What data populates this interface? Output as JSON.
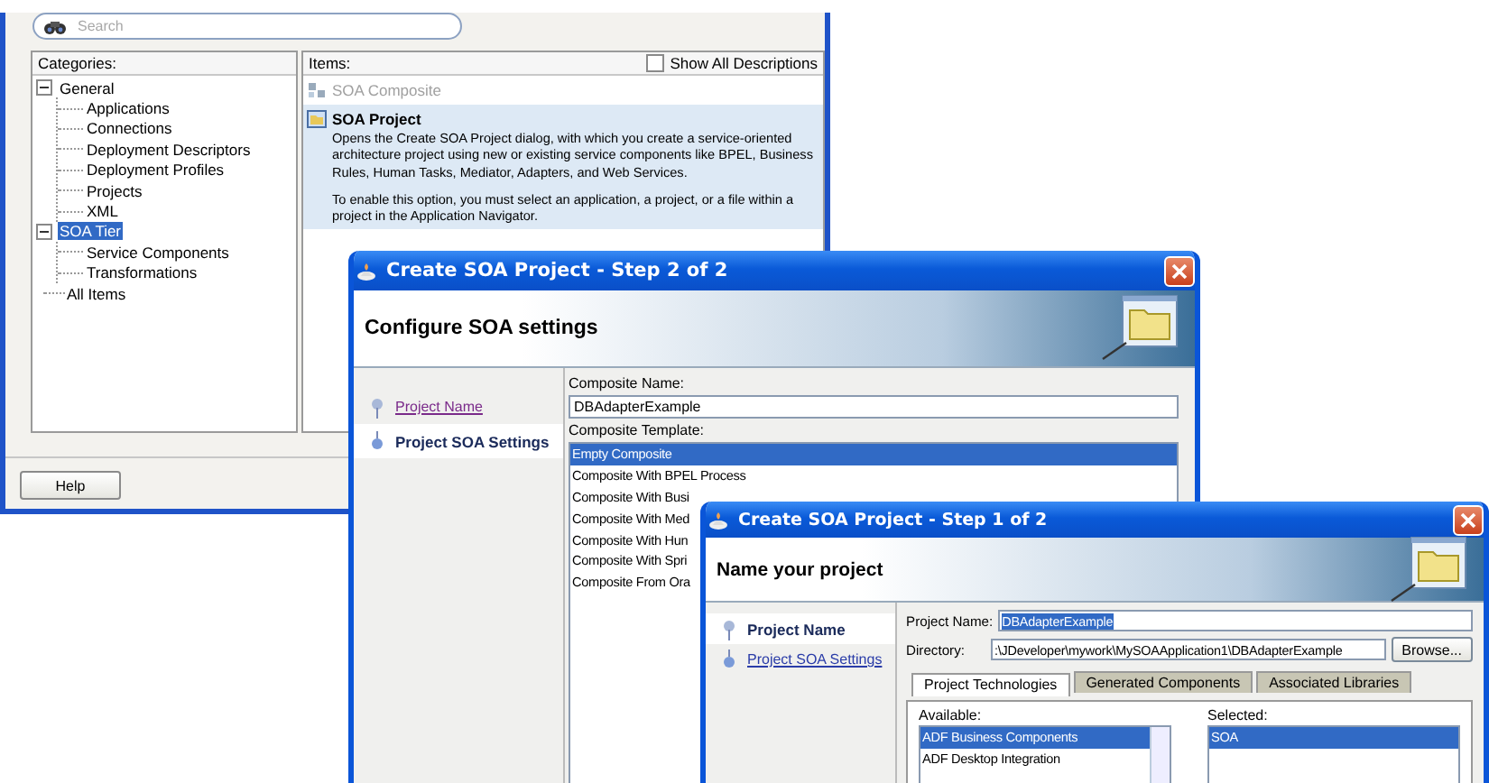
{
  "background_dialog": {
    "search": {
      "placeholder": "Search"
    },
    "categories": {
      "label": "Categories:",
      "tree": [
        {
          "label": "General",
          "expanded": true,
          "selected": false,
          "children": [
            {
              "label": "Applications",
              "selected": false
            },
            {
              "label": "Connections",
              "selected": false
            },
            {
              "label": "Deployment Descriptors",
              "selected": false
            },
            {
              "label": "Deployment Profiles",
              "selected": false
            },
            {
              "label": "Projects",
              "selected": false
            },
            {
              "label": "XML",
              "selected": false
            }
          ]
        },
        {
          "label": "SOA Tier",
          "expanded": true,
          "selected": true,
          "children": [
            {
              "label": "Service Components",
              "selected": false
            },
            {
              "label": "Transformations",
              "selected": false
            }
          ]
        },
        {
          "label": "All Items",
          "selected": false
        }
      ]
    },
    "items": {
      "label": "Items:",
      "show_all_descriptions": {
        "label": "Show All Descriptions",
        "checked": false
      },
      "list": [
        {
          "kind": "category",
          "title": "SOA Composite",
          "disabled": true
        },
        {
          "kind": "item",
          "title": "SOA Project",
          "selected": true,
          "description": [
            "Opens the Create SOA Project dialog, with which you create a service-oriented architecture project using new or existing service components like BPEL, Business Rules, Human Tasks, Mediator, Adapters, and Web Services.",
            "To enable this option, you must select an application, a project, or a file within a project in the Application Navigator."
          ]
        }
      ]
    },
    "help_button": "Help"
  },
  "step2_dialog": {
    "title": "Create SOA Project - Step 2 of 2",
    "heading": "Configure SOA settings",
    "nav": [
      {
        "label": "Project Name",
        "selected": false,
        "visited": true
      },
      {
        "label": "Project SOA Settings",
        "selected": true,
        "visited": false
      }
    ],
    "fields": [
      {
        "kind": "text",
        "label": "Composite Name:",
        "value": "DBAdapterExample",
        "highlighted": false
      },
      {
        "kind": "list",
        "label": "Composite Template:",
        "items": [
          {
            "label": "Empty Composite",
            "selected": true
          },
          {
            "label": "Composite With BPEL Process",
            "selected": false
          },
          {
            "label": "Composite With Busi",
            "selected": false
          },
          {
            "label": "Composite With Med",
            "selected": false
          },
          {
            "label": "Composite With Hun",
            "selected": false
          },
          {
            "label": "Composite With Spri",
            "selected": false
          },
          {
            "label": "Composite From Ora",
            "selected": false
          }
        ]
      }
    ]
  },
  "step1_dialog": {
    "title": "Create SOA Project - Step 1 of 2",
    "heading": "Name your project",
    "nav": [
      {
        "label": "Project Name",
        "selected": true,
        "visited": false
      },
      {
        "label": "Project SOA Settings",
        "selected": false,
        "visited": false
      }
    ],
    "fields": [
      {
        "kind": "inline_text",
        "label": "Project Name:",
        "value": "DBAdapterExample",
        "highlighted": true
      },
      {
        "kind": "path",
        "label": "Directory:",
        "value": ":\\JDeveloper\\mywork\\MySOAApplication1\\DBAdapterExample",
        "button": "Browse..."
      },
      {
        "kind": "tabs",
        "tabs": [
          {
            "label": "Project Technologies",
            "selected": true
          },
          {
            "label": "Generated Components",
            "selected": false
          },
          {
            "label": "Associated Libraries",
            "selected": false
          }
        ],
        "available": {
          "label": "Available:",
          "items": [
            {
              "label": "ADF Business Components",
              "selected": true
            },
            {
              "label": "ADF Desktop Integration",
              "selected": false
            }
          ]
        },
        "chosen": {
          "label": "Selected:",
          "items": [
            {
              "label": "SOA",
              "selected": true
            }
          ]
        }
      }
    ]
  }
}
